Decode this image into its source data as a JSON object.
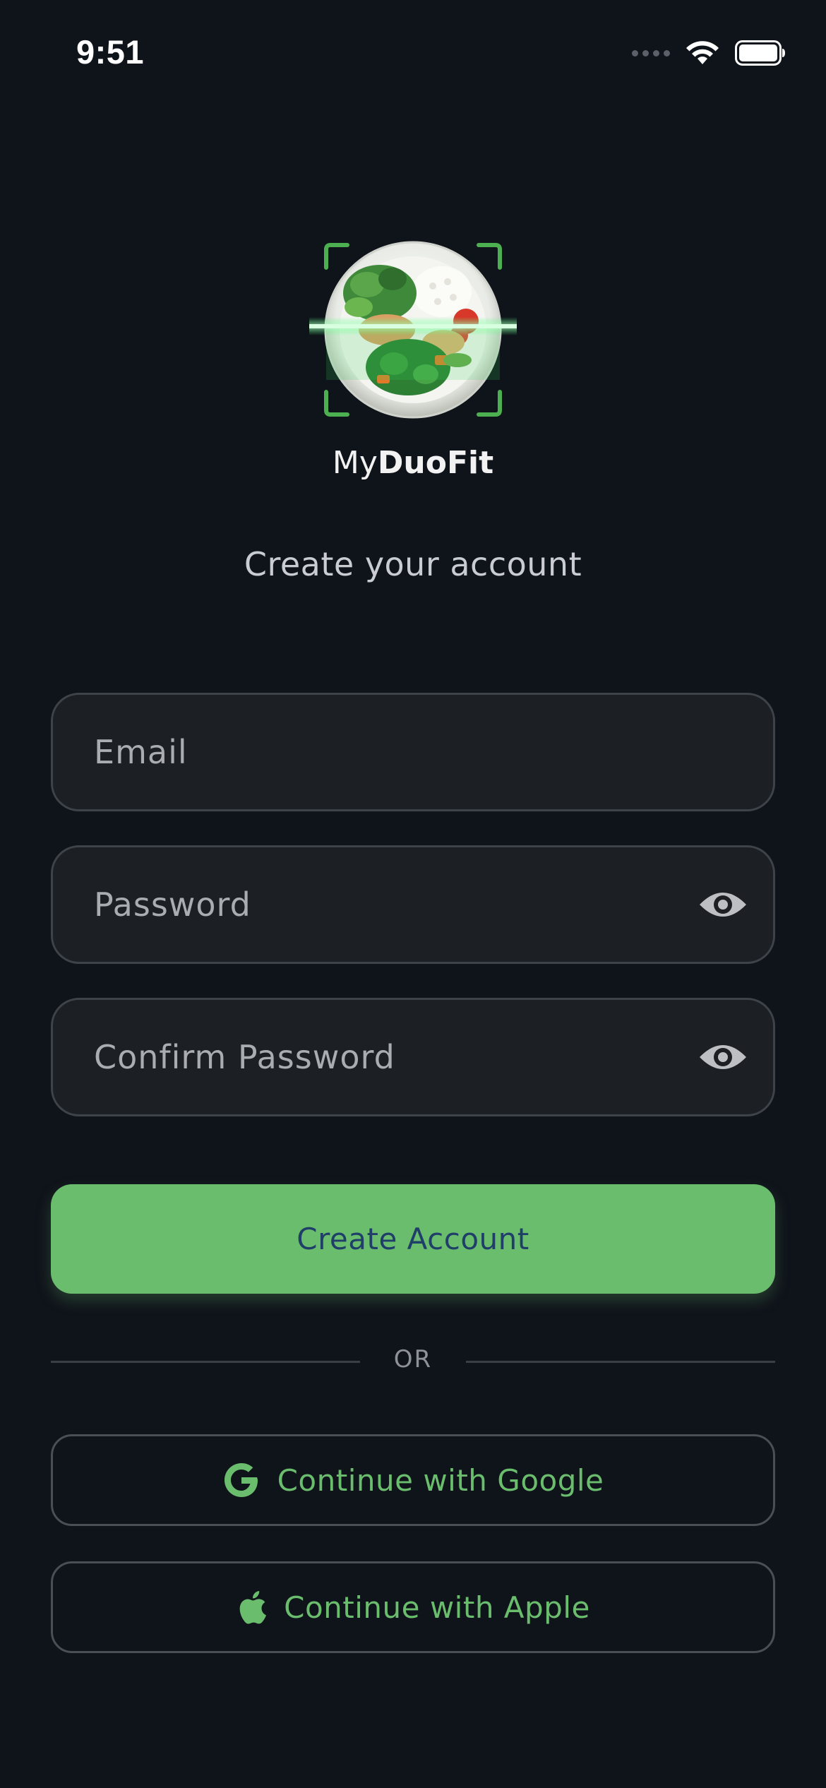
{
  "status_bar": {
    "time": "9:51",
    "icons": [
      "cellular-signal-icon",
      "wifi-icon",
      "battery-icon"
    ]
  },
  "brand": {
    "name_regular": "My",
    "name_bold": "DuoFit",
    "logo_icon": "food-scan-plate-icon"
  },
  "subtitle": "Create your account",
  "form": {
    "email_placeholder": "Email",
    "password_placeholder": "Password",
    "confirm_password_placeholder": "Confirm Password",
    "visibility_icon": "eye-icon"
  },
  "primary_button": {
    "label": "Create Account"
  },
  "divider": {
    "label": "OR"
  },
  "social": {
    "google_label": "Continue with Google",
    "apple_label": "Continue with Apple"
  },
  "colors": {
    "background": "#0f131a",
    "field_background": "#1c1f24",
    "accent_green": "#6bbd6e",
    "button_text": "#1f3f68"
  }
}
